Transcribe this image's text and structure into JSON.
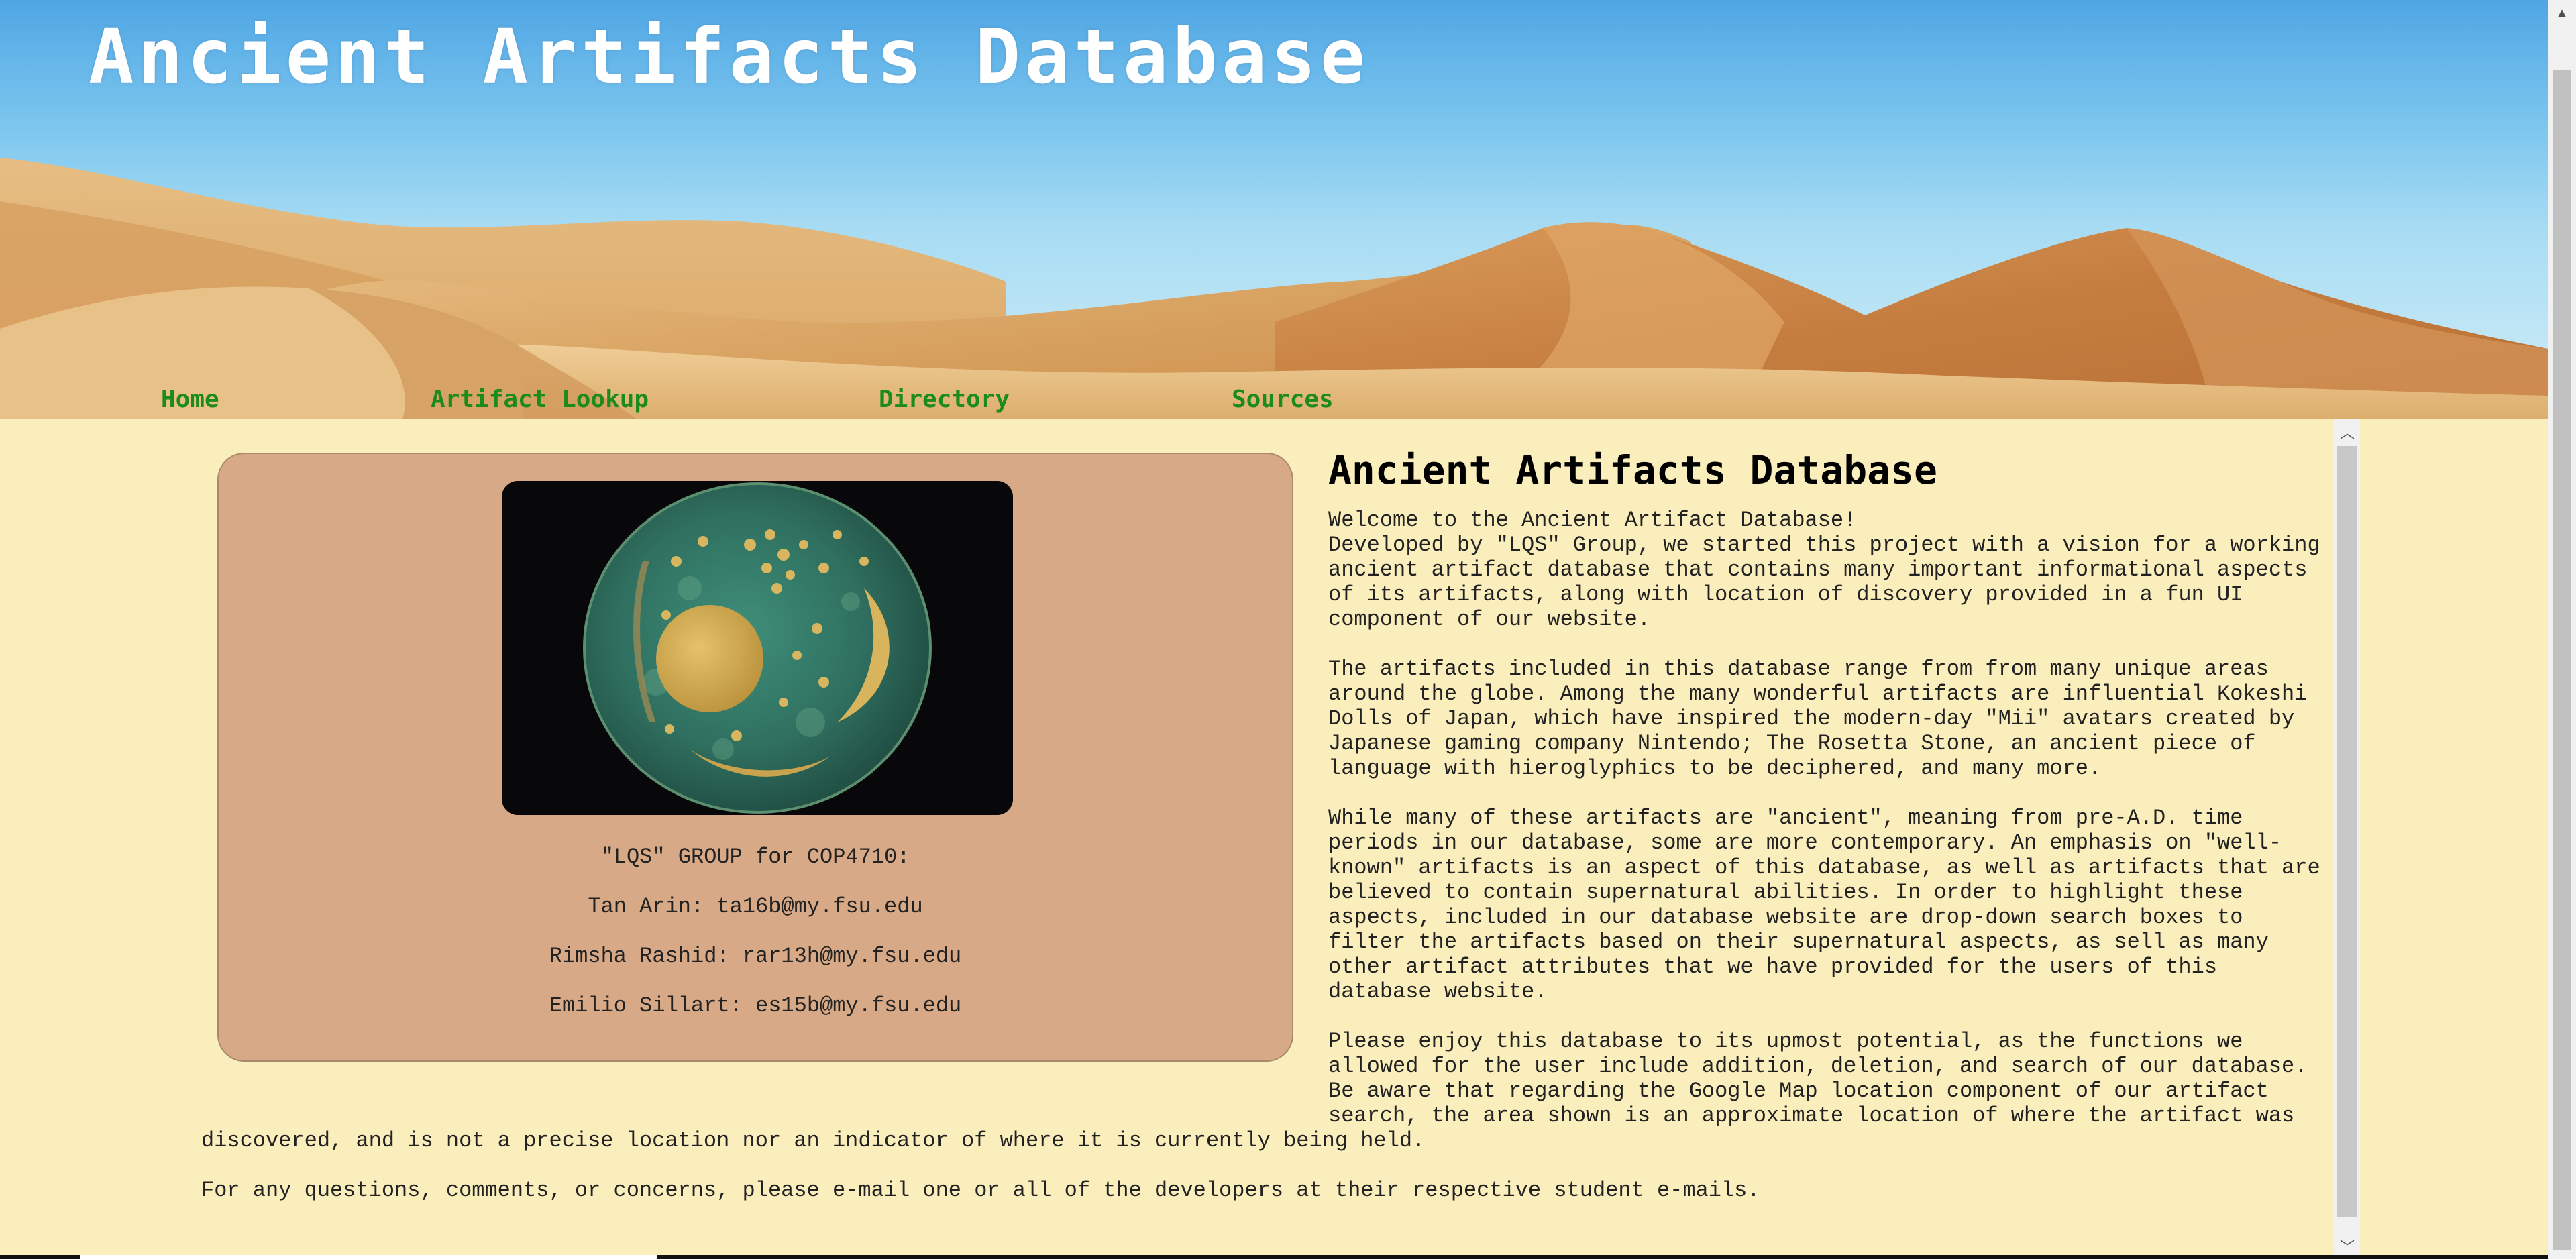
{
  "header": {
    "site_title": "Ancient Artifacts Database"
  },
  "nav": {
    "items": [
      {
        "label": "Home"
      },
      {
        "label": "Artifact Lookup"
      },
      {
        "label": "Directory"
      },
      {
        "label": "Sources"
      }
    ]
  },
  "team_card": {
    "group_line": "\"LQS\" GROUP for COP4710:",
    "members": [
      "Tan Arin: ta16b@my.fsu.edu",
      "Rimsha Rashid: rar13h@my.fsu.edu",
      "Emilio Sillart: es15b@my.fsu.edu"
    ]
  },
  "intro": {
    "title": "Ancient Artifacts Database",
    "welcome": "Welcome to the Ancient Artifact Database!",
    "paragraphs": [
      "Developed by \"LQS\" Group, we started this project with a vision for a working ancient artifact database that contains many important informational aspects of its artifacts, along with location of discovery provided in a fun UI component of our website.",
      "The artifacts included in this database range from from many unique areas around the globe. Among the many wonderful artifacts are influential Kokeshi Dolls of Japan, which have inspired the modern-day \"Mii\" avatars created by Japanese gaming company Nintendo; The Rosetta Stone, an ancient piece of language with hieroglyphics to be deciphered, and many more.",
      "While many of these artifacts are \"ancient\", meaning from pre-A.D. time periods in our database, some are more contemporary. An emphasis on \"well-known\" artifacts is an aspect of this database, as well as artifacts that are believed to contain supernatural abilities. In order to highlight these aspects, included in our database website are drop-down search boxes to filter the artifacts based on their supernatural aspects, as sell as many other artifact attributes that we have provided for the users of this database website.",
      "Please enjoy this database to its upmost potential, as the functions we allowed for the user include addition, deletion, and search of our database. Be aware that regarding the Google Map location component of our artifact search, the area shown is an approximate location of where the artifact was discovered, and is not a precise location nor an indicator of where it is currently being held.",
      "For any questions, comments, or concerns, please e-mail one or all of the developers at their respective student e-mails."
    ]
  },
  "icons": {
    "scroll_up": "chevron-up-icon",
    "scroll_down": "chevron-down-icon"
  },
  "colors": {
    "page_background": "#fbeebd",
    "card_background": "#d8a986",
    "nav_link": "#1b8b1b",
    "title_text": "#ffffff"
  }
}
